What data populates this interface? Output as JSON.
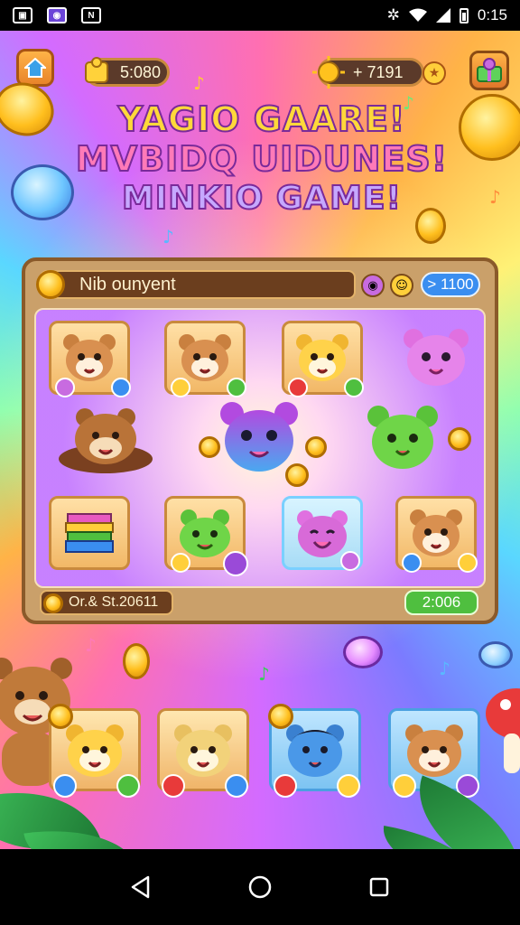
{
  "status_bar": {
    "time": "0:15",
    "left_icons": [
      "image-icon",
      "app-icon",
      "notification-icon"
    ],
    "right_icons": [
      "settings-icon",
      "wifi-icon",
      "signal-icon",
      "battery-icon"
    ]
  },
  "topbar": {
    "left_counter": "5:080",
    "right_counter": "+ 7191",
    "home_icon": "home-icon",
    "star_icon": "star-icon",
    "gift_icon": "gift-icon"
  },
  "title": {
    "line1": "YAGIO GAARE!",
    "line2": "MVBIDQ UIDUNES!",
    "line3": "MINKIO GAME!"
  },
  "board": {
    "header": "Nib ounyent",
    "score": "> 1100",
    "footer_left": "Or.& St.20611",
    "footer_right": "2:006"
  },
  "colors": {
    "wood": "#caa06a",
    "wood_dark": "#6b3e1e",
    "gold": "#ffbf1e",
    "blue_pill": "#3a8ef0",
    "green_pill": "#4fbf3f"
  },
  "nav": {
    "back_icon": "back-icon",
    "home_icon": "home-circle-icon",
    "recents_icon": "recents-icon"
  }
}
